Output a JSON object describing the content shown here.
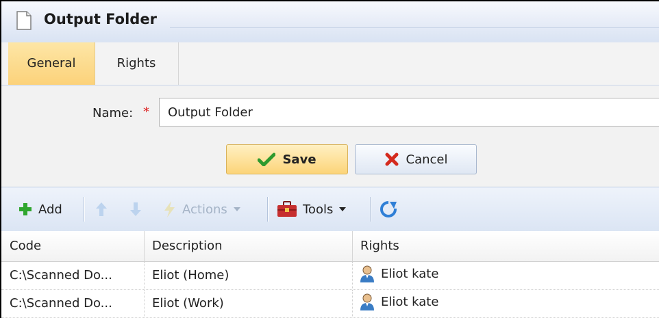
{
  "window": {
    "title": "Output Folder"
  },
  "tabs": [
    {
      "label": "General",
      "active": true
    },
    {
      "label": "Rights",
      "active": false
    }
  ],
  "form": {
    "name_label": "Name:",
    "required_marker": "*",
    "name_value": "Output Folder",
    "save_label": "Save",
    "cancel_label": "Cancel"
  },
  "toolbar": {
    "add_label": "Add",
    "actions_label": "Actions",
    "tools_label": "Tools"
  },
  "grid": {
    "columns": [
      "Code",
      "Description",
      "Rights"
    ],
    "rows": [
      {
        "code": "C:\\Scanned Do...",
        "description": "Eliot (Home)",
        "rights": "Eliot kate"
      },
      {
        "code": "C:\\Scanned Do...",
        "description": "Eliot (Work)",
        "rights": "Eliot kate"
      }
    ]
  },
  "colors": {
    "active_tab": "#fcd27a",
    "toolbar_bg": "#dbe5f4",
    "required": "#dd2222",
    "add_green": "#2fa62f",
    "cancel_red": "#d42a1e"
  }
}
